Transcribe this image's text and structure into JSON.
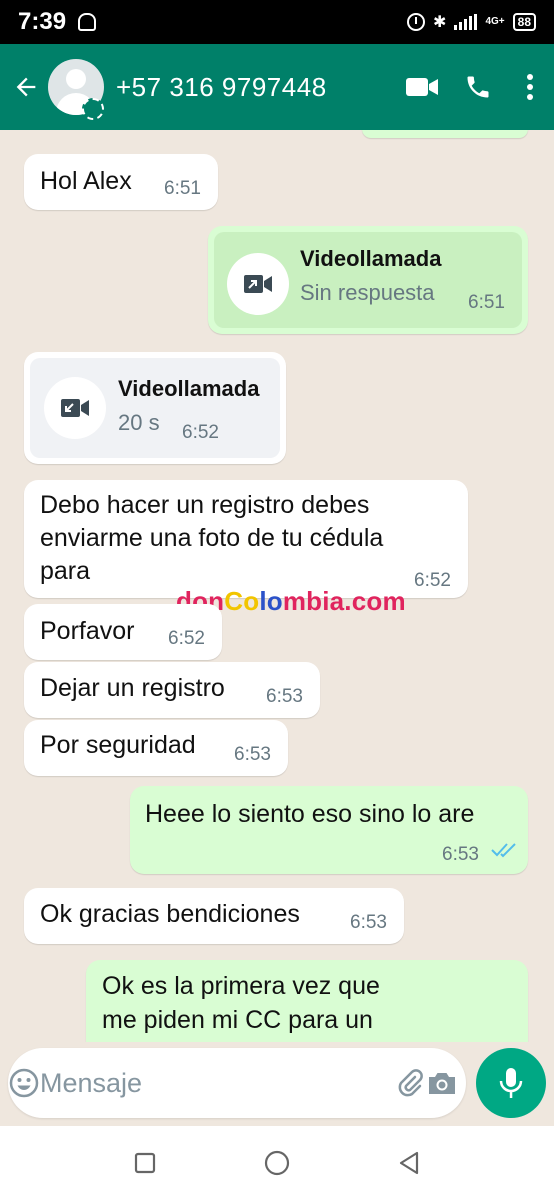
{
  "status_bar": {
    "time": "7:39",
    "network": "4G+",
    "battery": "88"
  },
  "header": {
    "contact": "+57 316 9797448"
  },
  "messages": {
    "m1": {
      "text": "Hol Alex",
      "time": "6:51"
    },
    "m2": {
      "title": "Videollamada",
      "subtitle": "Sin respuesta",
      "time": "6:51"
    },
    "m3": {
      "title": "Videollamada",
      "subtitle": "20 s",
      "time": "6:52"
    },
    "m4": {
      "line1": "Debo hacer un  registro debes",
      "line2": "enviarme una foto de tu cédula",
      "line3": "para",
      "time": "6:52"
    },
    "m5": {
      "text": "Porfavor",
      "time": "6:52"
    },
    "m6": {
      "text": "Dejar un registro",
      "time": "6:53"
    },
    "m7": {
      "text": "Por seguridad",
      "time": "6:53"
    },
    "m8": {
      "text": "Heee lo siento eso sino lo are",
      "time": "6:53"
    },
    "m9": {
      "text": "Ok gracias bendiciones",
      "time": "6:53"
    },
    "m10": {
      "line1": "Ok es la primera vez que",
      "line2": "me piden mi CC para un"
    }
  },
  "watermark": {
    "p1": "don",
    "p2": "Co",
    "p3": "lo",
    "p4": "mbia.com"
  },
  "input": {
    "placeholder": "Mensaje"
  },
  "colors": {
    "header": "#008069",
    "incoming": "#ffffff",
    "outgoing": "#d9fdd3",
    "accent": "#00a884",
    "read_ticks": "#53bdeb"
  }
}
